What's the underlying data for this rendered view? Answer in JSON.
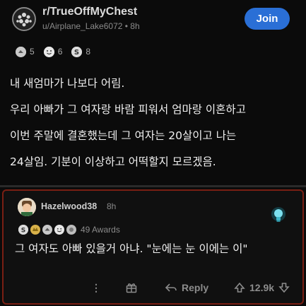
{
  "post": {
    "subreddit": "r/TrueOffMyChest",
    "author_line": "u/Airplane_Lake6072 • 8h",
    "join_label": "Join",
    "awards": [
      {
        "icon": "helpful-award-icon",
        "count": "5"
      },
      {
        "icon": "wholesome-award-icon",
        "count": "6"
      },
      {
        "icon": "silver-award-icon",
        "count": "8"
      }
    ],
    "body_lines": [
      "내 새엄마가 나보다 어림.",
      "우리 아빠가 그 여자랑 바람 피워서 엄마랑 이혼하고",
      "이번 주말에 결혼했는데 그 여자는 20살이고 나는",
      "24살임. 기분이 이상하고 어떡할지 모르겠음."
    ]
  },
  "comment": {
    "username": "Hazelwood38",
    "time": "8h",
    "awards_label": "49 Awards",
    "text": "그 여자도 아빠 있을거 아냐. \"눈에는 눈 이에는 이\"",
    "actions": {
      "more": "⋮",
      "reply_label": "Reply",
      "vote_count": "12.9k"
    }
  },
  "colors": {
    "join_button": "#2a6fd6",
    "comment_border": "#7a1f13",
    "background": "#0b0b0b"
  }
}
